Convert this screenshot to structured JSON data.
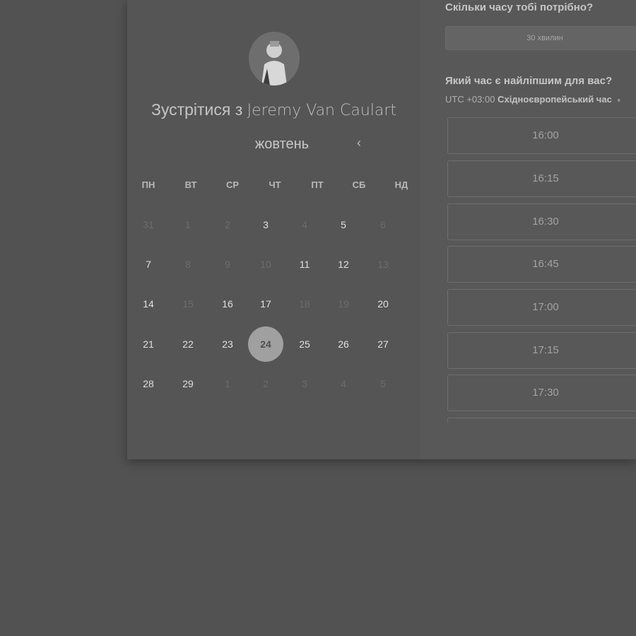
{
  "booking": {
    "title_prefix": "Зустрітися з",
    "host_name": "Jeremy Van Caulart",
    "avatar": "host-avatar-photo"
  },
  "calendar": {
    "prev_icon": "‹",
    "next_icon": "›",
    "month": "жовтень",
    "weekdays": [
      "ПН",
      "ВТ",
      "СР",
      "ЧТ",
      "ПТ",
      "СБ",
      "НД"
    ],
    "weeks": [
      [
        {
          "d": "31",
          "s": "muted"
        },
        {
          "d": "1",
          "s": "muted"
        },
        {
          "d": "2",
          "s": "muted"
        },
        {
          "d": "3",
          "s": "avail"
        },
        {
          "d": "4",
          "s": "muted"
        },
        {
          "d": "5",
          "s": "avail"
        },
        {
          "d": "6",
          "s": "muted"
        }
      ],
      [
        {
          "d": "7",
          "s": "avail"
        },
        {
          "d": "8",
          "s": "muted"
        },
        {
          "d": "9",
          "s": "muted"
        },
        {
          "d": "10",
          "s": "muted"
        },
        {
          "d": "11",
          "s": "avail"
        },
        {
          "d": "12",
          "s": "avail"
        },
        {
          "d": "13",
          "s": "muted"
        }
      ],
      [
        {
          "d": "14",
          "s": "avail"
        },
        {
          "d": "15",
          "s": "muted"
        },
        {
          "d": "16",
          "s": "avail"
        },
        {
          "d": "17",
          "s": "avail"
        },
        {
          "d": "18",
          "s": "muted"
        },
        {
          "d": "19",
          "s": "muted"
        },
        {
          "d": "20",
          "s": "avail"
        }
      ],
      [
        {
          "d": "21",
          "s": "avail"
        },
        {
          "d": "22",
          "s": "avail"
        },
        {
          "d": "23",
          "s": "avail"
        },
        {
          "d": "24",
          "s": "selected"
        },
        {
          "d": "25",
          "s": "avail"
        },
        {
          "d": "26",
          "s": "avail"
        },
        {
          "d": "27",
          "s": "avail"
        }
      ],
      [
        {
          "d": "28",
          "s": "avail"
        },
        {
          "d": "29",
          "s": "avail"
        },
        {
          "d": "1",
          "s": "muted"
        },
        {
          "d": "2",
          "s": "muted"
        },
        {
          "d": "3",
          "s": "muted"
        },
        {
          "d": "4",
          "s": "muted"
        },
        {
          "d": "5",
          "s": "muted"
        }
      ]
    ]
  },
  "duration": {
    "question": "Скільки часу тобі потрібно?",
    "selected": "30 хвилин"
  },
  "time": {
    "question": "Який час є найліпшим для вас?",
    "tz_offset": "UTC +03:00",
    "tz_name": "Східноєвропейський час",
    "tz_caret": "▾",
    "slots": [
      "16:00",
      "16:15",
      "16:30",
      "16:45",
      "17:00",
      "17:15",
      "17:30",
      ""
    ]
  },
  "colors": {
    "overlay_bg": "#525252",
    "selected_day": "#a0a0a0"
  }
}
